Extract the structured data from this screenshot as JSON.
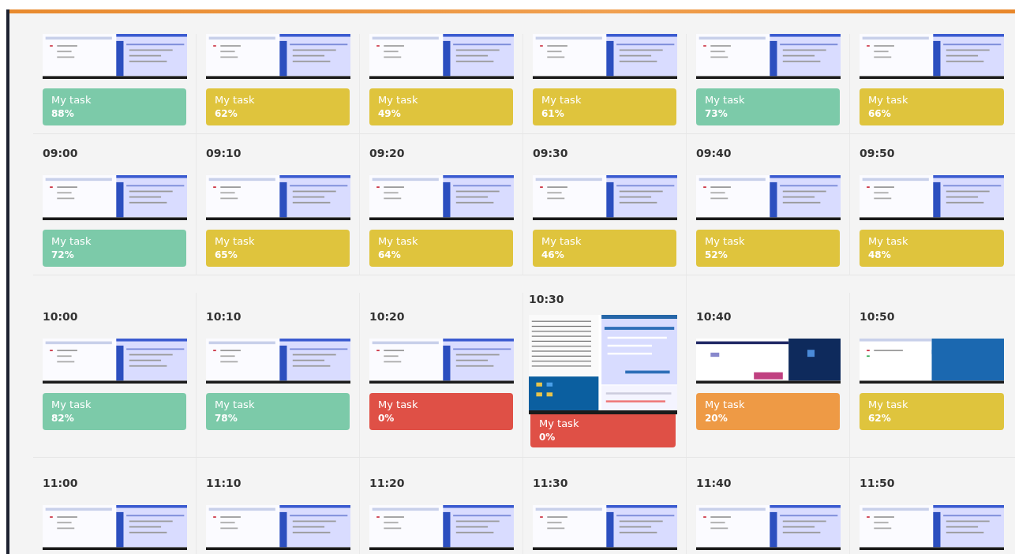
{
  "rows": [
    {
      "cells": [
        {
          "thumbnail": {
            "kind": "windows"
          },
          "task": {
            "label": "My task",
            "percent": "88%",
            "color": "#7ccaa9"
          }
        },
        {
          "thumbnail": {
            "kind": "windows"
          },
          "task": {
            "label": "My task",
            "percent": "62%",
            "color": "#dfc43d"
          }
        },
        {
          "thumbnail": {
            "kind": "windows"
          },
          "task": {
            "label": "My task",
            "percent": "49%",
            "color": "#dfc43d"
          }
        },
        {
          "thumbnail": {
            "kind": "windows"
          },
          "task": {
            "label": "My task",
            "percent": "61%",
            "color": "#dfc43d"
          }
        },
        {
          "thumbnail": {
            "kind": "windows"
          },
          "task": {
            "label": "My task",
            "percent": "73%",
            "color": "#7ccaa9"
          }
        },
        {
          "thumbnail": {
            "kind": "windows"
          },
          "task": {
            "label": "My task",
            "percent": "66%",
            "color": "#dfc43d"
          }
        }
      ]
    },
    {
      "cells": [
        {
          "time": "09:00",
          "thumbnail": {
            "kind": "windows"
          },
          "task": {
            "label": "My task",
            "percent": "72%",
            "color": "#7ccaa9"
          }
        },
        {
          "time": "09:10",
          "thumbnail": {
            "kind": "windows"
          },
          "task": {
            "label": "My task",
            "percent": "65%",
            "color": "#dfc43d"
          }
        },
        {
          "time": "09:20",
          "thumbnail": {
            "kind": "windows"
          },
          "task": {
            "label": "My task",
            "percent": "64%",
            "color": "#dfc43d"
          }
        },
        {
          "time": "09:30",
          "thumbnail": {
            "kind": "windows"
          },
          "task": {
            "label": "My task",
            "percent": "46%",
            "color": "#dfc43d"
          }
        },
        {
          "time": "09:40",
          "thumbnail": {
            "kind": "windows"
          },
          "task": {
            "label": "My task",
            "percent": "52%",
            "color": "#dfc43d"
          }
        },
        {
          "time": "09:50",
          "thumbnail": {
            "kind": "windows"
          },
          "task": {
            "label": "My task",
            "percent": "48%",
            "color": "#dfc43d"
          }
        }
      ]
    },
    {
      "cells": [
        {
          "time": "10:00",
          "thumbnail": {
            "kind": "windows"
          },
          "task": {
            "label": "My task",
            "percent": "82%",
            "color": "#7ccaa9"
          }
        },
        {
          "time": "10:10",
          "thumbnail": {
            "kind": "windows"
          },
          "task": {
            "label": "My task",
            "percent": "78%",
            "color": "#7ccaa9"
          }
        },
        {
          "time": "10:20",
          "thumbnail": {
            "kind": "windows"
          },
          "task": {
            "label": "My task",
            "percent": "0%",
            "color": "#df5046"
          }
        },
        {
          "time": "10:30",
          "enlarged": true,
          "thumbnail": {
            "kind": "tiled"
          },
          "task": {
            "label": "My task",
            "percent": "0%",
            "color": "#df5046"
          }
        },
        {
          "time": "10:40",
          "thumbnail": {
            "kind": "dark"
          },
          "task": {
            "label": "My task",
            "percent": "20%",
            "color": "#ee9a45"
          }
        },
        {
          "time": "10:50",
          "thumbnail": {
            "kind": "blue"
          },
          "task": {
            "label": "My task",
            "percent": "62%",
            "color": "#dfc43d"
          }
        }
      ]
    },
    {
      "cells": [
        {
          "time": "11:00",
          "thumbnail": {
            "kind": "windows"
          }
        },
        {
          "time": "11:10",
          "thumbnail": {
            "kind": "windows"
          }
        },
        {
          "time": "11:20",
          "thumbnail": {
            "kind": "windows"
          }
        },
        {
          "time": "11:30",
          "thumbnail": {
            "kind": "windows"
          }
        },
        {
          "time": "11:40",
          "thumbnail": {
            "kind": "windows"
          }
        },
        {
          "time": "11:50",
          "thumbnail": {
            "kind": "windows"
          }
        }
      ]
    }
  ]
}
